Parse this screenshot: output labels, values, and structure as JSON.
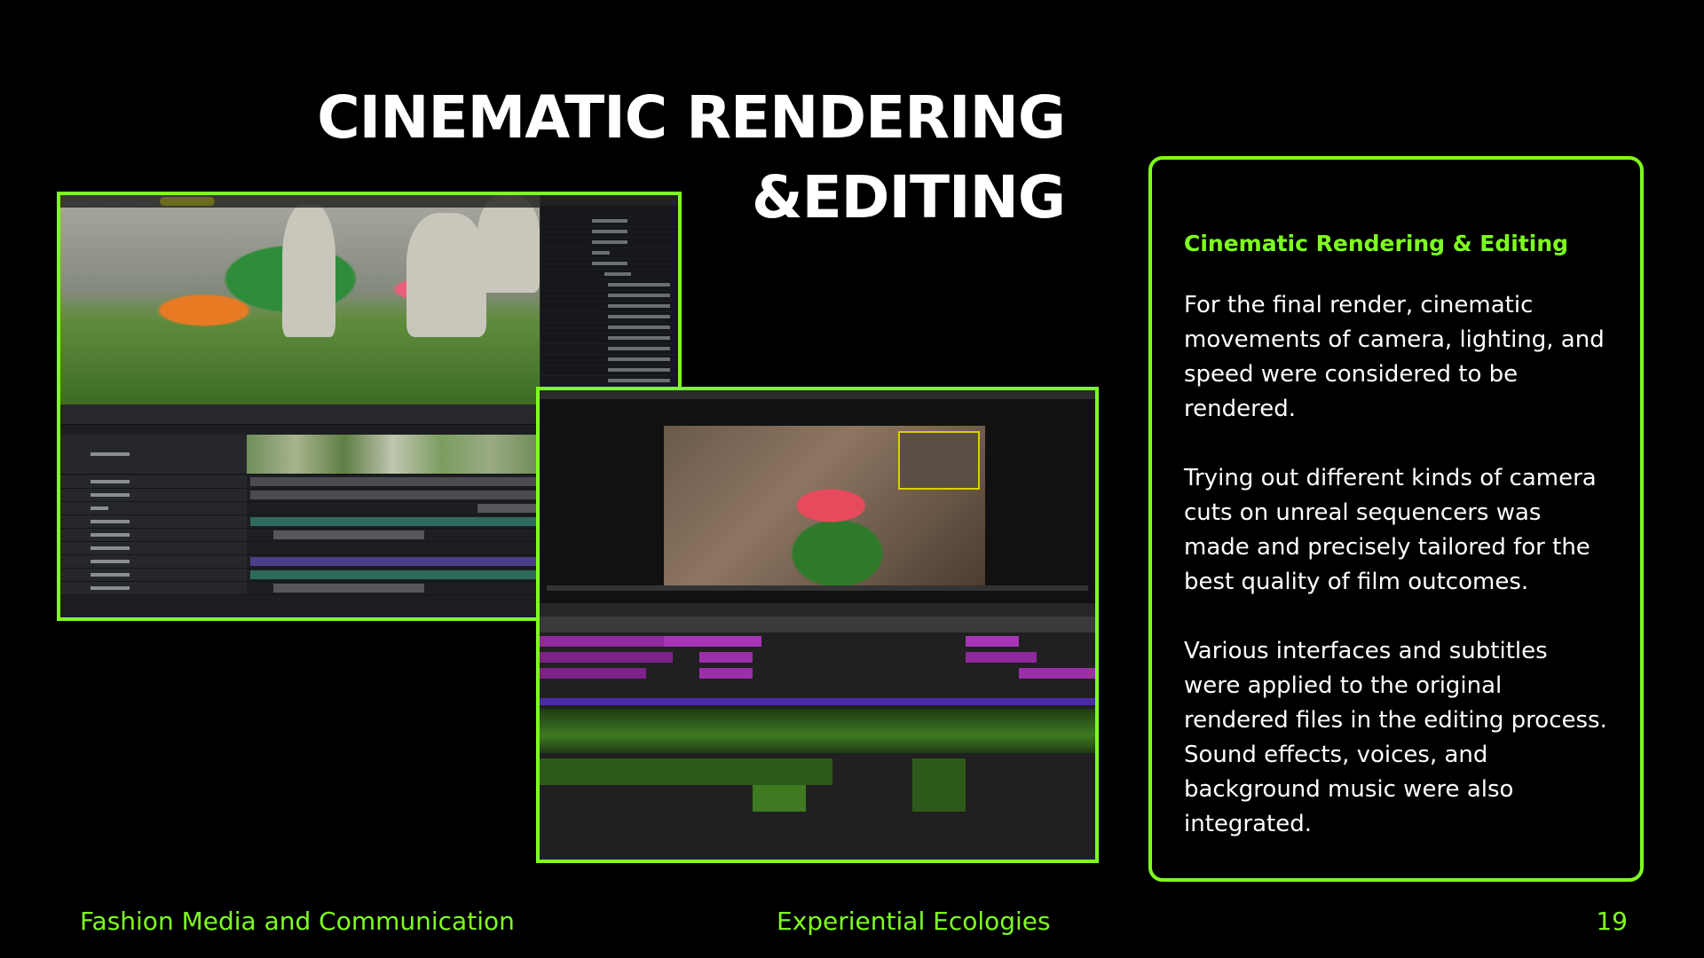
{
  "title": {
    "line1": "CINEMATIC RENDERING",
    "line2": "&EDITING"
  },
  "text_box": {
    "heading": "Cinematic Rendering & Editing",
    "paragraphs": [
      "For the final render, cinematic movements of camera, lighting, and speed were considered to be rendered.",
      "Trying out different kinds of camera cuts on unreal sequencers was made and precisely tailored for the best quality of film outcomes.",
      "Various interfaces and subtitles were applied to the original rendered files in the editing process. Sound effects, voices, and background music were also integrated."
    ]
  },
  "footer": {
    "left": "Fashion Media and Communication",
    "center": "Experiential Ecologies",
    "page_number": "19"
  },
  "colors": {
    "accent": "#7fff1e",
    "background": "#000000",
    "text": "#ffffff"
  }
}
